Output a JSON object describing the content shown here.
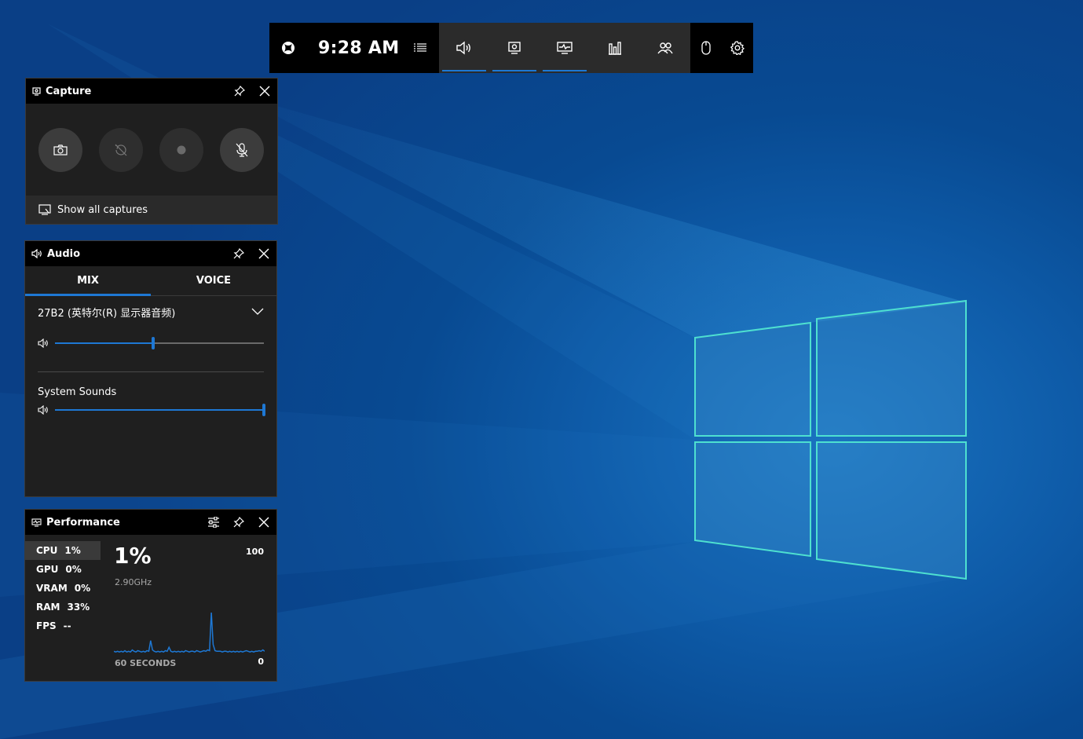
{
  "gamebar": {
    "time": "9:28 AM",
    "left_icons": [
      "xbox-icon",
      "menu-icon"
    ],
    "widget_icons": [
      "audio-icon",
      "capture-icon",
      "performance-icon",
      "resources-icon",
      "social-icon"
    ],
    "right_icons": [
      "mouse-icon",
      "gear-icon"
    ],
    "active_widgets": [
      "audio-icon",
      "capture-icon",
      "performance-icon"
    ]
  },
  "capture": {
    "title": "Capture",
    "buttons": [
      "screenshot",
      "record-last-30s",
      "start-recording",
      "mic-off"
    ],
    "show_all_label": "Show all captures"
  },
  "audio": {
    "title": "Audio",
    "tabs": [
      {
        "label": "MIX",
        "active": true
      },
      {
        "label": "VOICE",
        "active": false
      }
    ],
    "device_name": "27B2 (英特尔(R) 显示器音频)",
    "device_volume": 0.47,
    "apps": [
      {
        "name": "System Sounds",
        "volume": 1.0
      }
    ]
  },
  "performance": {
    "title": "Performance",
    "metrics": [
      {
        "name": "CPU",
        "value": "1%",
        "active": true
      },
      {
        "name": "GPU",
        "value": "0%"
      },
      {
        "name": "VRAM",
        "value": "0%"
      },
      {
        "name": "RAM",
        "value": "33%"
      },
      {
        "name": "FPS",
        "value": "--"
      }
    ],
    "current_value": "1%",
    "frequency": "2.90GHz",
    "max_label": "100",
    "min_label": "0",
    "span_label": "60 SECONDS"
  },
  "chart_data": {
    "type": "line",
    "title": "",
    "xlabel": "60 SECONDS",
    "ylabel": "",
    "ylim": [
      0,
      100
    ],
    "series": [
      {
        "values": [
          2,
          1,
          2,
          1,
          2,
          1,
          3,
          1,
          2,
          1,
          4,
          2,
          1,
          3,
          2,
          1,
          2,
          1,
          3,
          2,
          18,
          4,
          2,
          1,
          2,
          1,
          2,
          1,
          3,
          2,
          8,
          2,
          1,
          2,
          1,
          2,
          1,
          2,
          1,
          3,
          2,
          1,
          2,
          2,
          1,
          3,
          2,
          1,
          2,
          3,
          2,
          4,
          3,
          60,
          12,
          3,
          2,
          2,
          2,
          1,
          2,
          2,
          1,
          2,
          1,
          2,
          1,
          2,
          1,
          2,
          1,
          2,
          3,
          2,
          1,
          2,
          1,
          2,
          2,
          3,
          2,
          4,
          2
        ]
      }
    ],
    "color": "#1e78d4"
  },
  "colors": {
    "accent": "#1e78d4"
  }
}
